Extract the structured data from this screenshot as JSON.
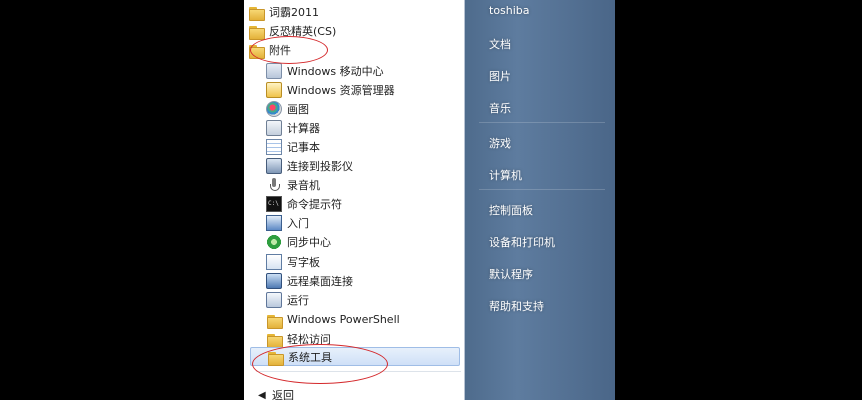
{
  "programs": {
    "items": [
      {
        "label": "词霸2011",
        "icon": "folder-icon"
      },
      {
        "label": "反恐精英(CS)",
        "icon": "folder-icon"
      },
      {
        "label": "附件",
        "icon": "folder-icon"
      },
      {
        "label": "Windows 移动中心",
        "icon": "mobility-center-icon"
      },
      {
        "label": "Windows 资源管理器",
        "icon": "explorer-icon"
      },
      {
        "label": "画图",
        "icon": "paint-icon"
      },
      {
        "label": "计算器",
        "icon": "calculator-icon"
      },
      {
        "label": "记事本",
        "icon": "notepad-icon"
      },
      {
        "label": "连接到投影仪",
        "icon": "projector-icon"
      },
      {
        "label": "录音机",
        "icon": "microphone-icon"
      },
      {
        "label": "命令提示符",
        "icon": "command-prompt-icon"
      },
      {
        "label": "入门",
        "icon": "getting-started-icon"
      },
      {
        "label": "同步中心",
        "icon": "sync-center-icon"
      },
      {
        "label": "写字板",
        "icon": "wordpad-icon"
      },
      {
        "label": "远程桌面连接",
        "icon": "remote-desktop-icon"
      },
      {
        "label": "运行",
        "icon": "run-icon"
      },
      {
        "label": "Windows PowerShell",
        "icon": "folder-icon"
      },
      {
        "label": "轻松访问",
        "icon": "folder-icon"
      },
      {
        "label": "系统工具",
        "icon": "folder-icon"
      }
    ],
    "back_label": "返回"
  },
  "right_pane": {
    "user": "toshiba",
    "documents": "文档",
    "pictures": "图片",
    "music": "音乐",
    "games": "游戏",
    "computer": "计算机",
    "control_panel": "控制面板",
    "devices_printers": "设备和打印机",
    "default_programs": "默认程序",
    "help_support": "帮助和支持"
  },
  "colors": {
    "right_pane": "#5a7799",
    "selection": "#cfe0f7",
    "annotation": "#d4282b"
  }
}
